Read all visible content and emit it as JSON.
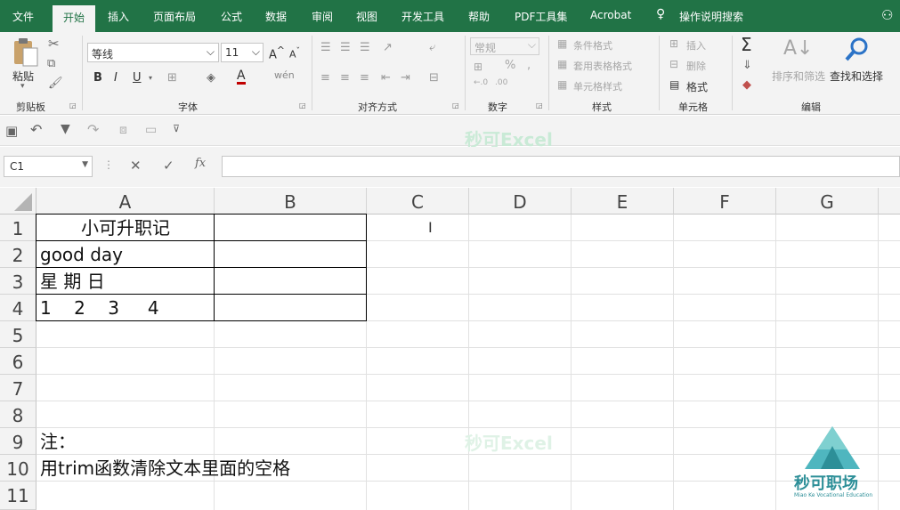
{
  "ribbon_tabs": [
    "文件",
    "开始",
    "插入",
    "页面布局",
    "公式",
    "数据",
    "审阅",
    "视图",
    "开发工具",
    "帮助",
    "PDF工具集",
    "Acrobat"
  ],
  "tell_me": "操作说明搜索",
  "clipboard": {
    "paste": "粘贴",
    "label": "剪贴板"
  },
  "font": {
    "name": "等线",
    "size": "11",
    "label": "字体"
  },
  "alignment": {
    "label": "对齐方式"
  },
  "number": {
    "format": "常规",
    "label": "数字"
  },
  "styles": {
    "conditional": "条件格式",
    "table": "套用表格格式",
    "cell": "单元格样式",
    "label": "样式"
  },
  "cells": {
    "insert": "插入",
    "delete": "删除",
    "format": "格式",
    "label": "单元格"
  },
  "editing": {
    "sort": "排序和筛选",
    "find": "查找和选择",
    "label": "编辑"
  },
  "watermark": "秒可Excel",
  "name_box": "C1",
  "columns": [
    "A",
    "B",
    "C",
    "D",
    "E",
    "F",
    "G"
  ],
  "rows": [
    "1",
    "2",
    "3",
    "4",
    "5",
    "6",
    "7",
    "8",
    "9",
    "10",
    "11"
  ],
  "cells_data": {
    "A1": "小可升职记",
    "A2": "good day",
    "A3": "星 期 日",
    "A4": "1    2    3     4",
    "A9": "注：",
    "A10": "用trim函数清除文本里面的空格"
  },
  "logo": {
    "name": "秒可职场",
    "sub": "Miao Ke Vocational Education"
  },
  "colors": {
    "excel_green": "#217346",
    "grid_line": "#e1e1e1"
  }
}
